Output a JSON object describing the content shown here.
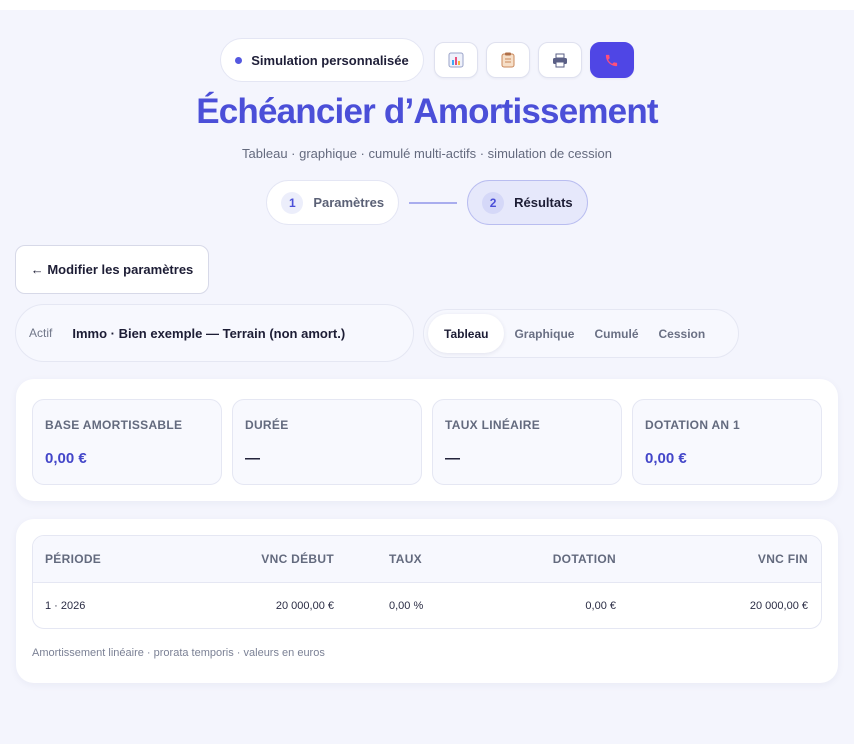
{
  "header": {
    "badge_label": "Simulation personnalisée",
    "title": "Échéancier d’Amortissement",
    "subtitle": "Tableau · graphique · cumulé multi-actifs · simulation de cession",
    "icons": [
      "chart-icon",
      "clipboard-icon",
      "printer-icon",
      "phone-icon"
    ]
  },
  "stepper": {
    "steps": [
      {
        "num": "1",
        "label": "Paramètres"
      },
      {
        "num": "2",
        "label": "Résultats"
      }
    ]
  },
  "back_button": "← Modifier les paramètres",
  "actif": {
    "label": "Actif",
    "value": "Immo · Bien exemple — Terrain (non amort.)"
  },
  "tabs": [
    "Tableau",
    "Graphique",
    "Cumulé",
    "Cession"
  ],
  "stats": [
    {
      "label": "BASE AMORTISSABLE",
      "value": "0,00 €"
    },
    {
      "label": "DURÉE",
      "value": "—"
    },
    {
      "label": "TAUX LINÉAIRE",
      "value": "—"
    },
    {
      "label": "DOTATION AN 1",
      "value": "0,00 €"
    }
  ],
  "table": {
    "headers": [
      "PÉRIODE",
      "VNC DÉBUT",
      "TAUX",
      "DOTATION",
      "VNC FIN"
    ],
    "rows": [
      [
        "1 · 2026",
        "20 000,00 €",
        "0,00 %",
        "0,00 €",
        "20 000,00 €"
      ]
    ]
  },
  "footnote": "Amortissement linéaire · prorata temporis · valeurs en euros",
  "colors": {
    "accent": "#4f46e5",
    "title": "#4b4fd8",
    "background": "#f4f5fd"
  }
}
